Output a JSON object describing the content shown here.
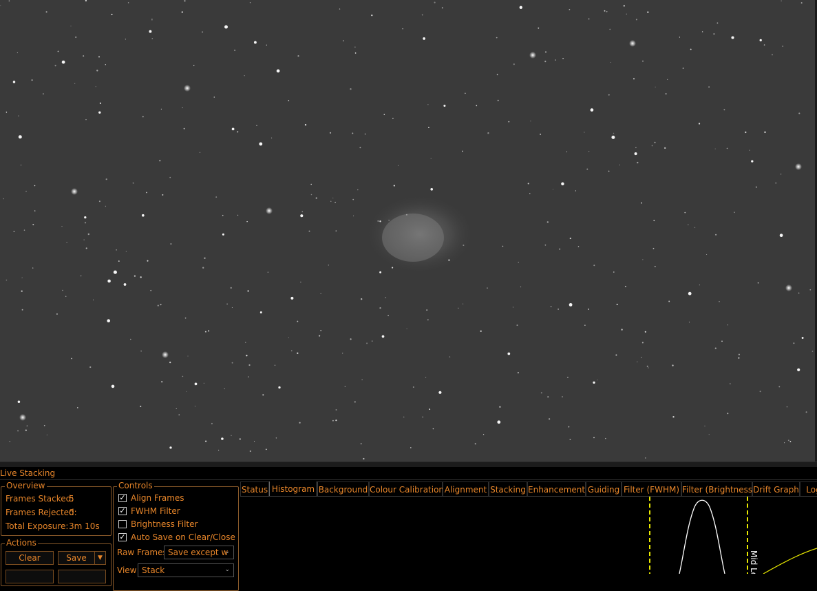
{
  "image_viewer": {
    "description_icon": "star-field-image",
    "background_color": "#3a3a3a"
  },
  "live_stacking": {
    "title": "Live Stacking",
    "overview": {
      "legend": "Overview",
      "frames_stacked_label": "Frames Stacked:",
      "frames_stacked_value": "5",
      "frames_rejected_label": "Frames Rejected:",
      "frames_rejected_value": "0",
      "total_exposure_label": "Total Exposure:",
      "total_exposure_value": "3m 10s"
    },
    "actions": {
      "legend": "Actions",
      "clear_label": "Clear",
      "save_label": "Save"
    },
    "controls": {
      "legend": "Controls",
      "align_frames_label": "Align Frames",
      "align_frames_checked": true,
      "fwhm_filter_label": "FWHM Filter",
      "fwhm_filter_checked": true,
      "brightness_filter_label": "Brightness Filter",
      "brightness_filter_checked": false,
      "auto_save_label": "Auto Save on Clear/Close",
      "auto_save_checked": true,
      "raw_frames_label": "Raw Frames",
      "raw_frames_value": "Save except w",
      "view_label": "View",
      "view_value": "Stack"
    },
    "tabs": [
      {
        "label": "Status",
        "active": false
      },
      {
        "label": "Histogram",
        "active": true
      },
      {
        "label": "Background",
        "active": false
      },
      {
        "label": "Colour Calibration",
        "active": false
      },
      {
        "label": "Alignment",
        "active": false
      },
      {
        "label": "Stacking",
        "active": false
      },
      {
        "label": "Enhancement",
        "active": false
      },
      {
        "label": "Guiding",
        "active": false
      },
      {
        "label": "Filter (FWHM)",
        "active": false
      },
      {
        "label": "Filter (Brightness)",
        "active": false
      },
      {
        "label": "Drift Graph",
        "active": false
      },
      {
        "label": "Log",
        "active": false
      }
    ],
    "histogram": {
      "mid_level_label": "Mid Le",
      "marker_color": "#e8e800",
      "curve_color": "#ffffff"
    }
  },
  "colors": {
    "accent": "#e8862a",
    "group_border": "#8a5a2a"
  }
}
